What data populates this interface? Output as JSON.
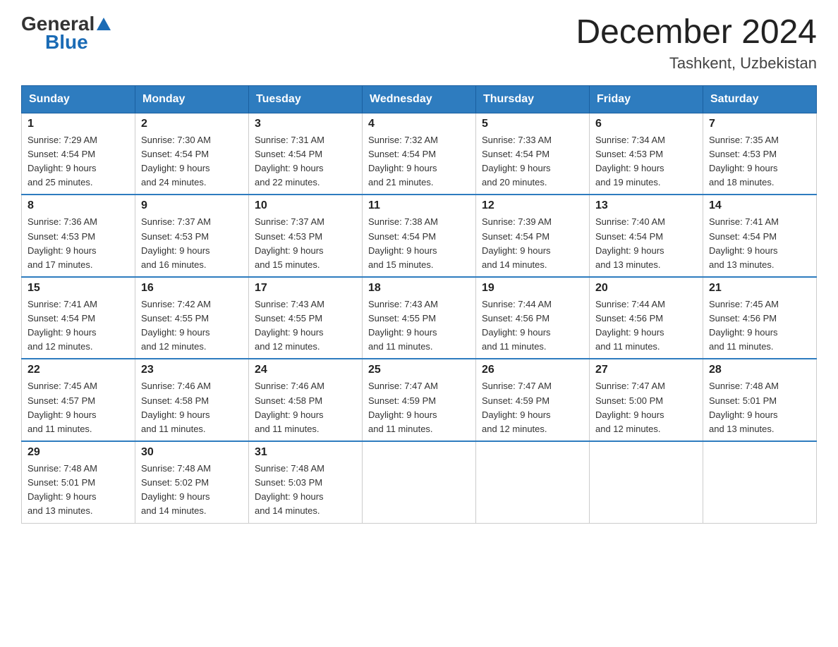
{
  "logo": {
    "general": "General",
    "blue": "Blue",
    "tagline": "Blue"
  },
  "header": {
    "month_year": "December 2024",
    "location": "Tashkent, Uzbekistan"
  },
  "columns": [
    "Sunday",
    "Monday",
    "Tuesday",
    "Wednesday",
    "Thursday",
    "Friday",
    "Saturday"
  ],
  "weeks": [
    [
      {
        "day": "1",
        "sunrise": "7:29 AM",
        "sunset": "4:54 PM",
        "daylight": "9 hours and 25 minutes."
      },
      {
        "day": "2",
        "sunrise": "7:30 AM",
        "sunset": "4:54 PM",
        "daylight": "9 hours and 24 minutes."
      },
      {
        "day": "3",
        "sunrise": "7:31 AM",
        "sunset": "4:54 PM",
        "daylight": "9 hours and 22 minutes."
      },
      {
        "day": "4",
        "sunrise": "7:32 AM",
        "sunset": "4:54 PM",
        "daylight": "9 hours and 21 minutes."
      },
      {
        "day": "5",
        "sunrise": "7:33 AM",
        "sunset": "4:54 PM",
        "daylight": "9 hours and 20 minutes."
      },
      {
        "day": "6",
        "sunrise": "7:34 AM",
        "sunset": "4:53 PM",
        "daylight": "9 hours and 19 minutes."
      },
      {
        "day": "7",
        "sunrise": "7:35 AM",
        "sunset": "4:53 PM",
        "daylight": "9 hours and 18 minutes."
      }
    ],
    [
      {
        "day": "8",
        "sunrise": "7:36 AM",
        "sunset": "4:53 PM",
        "daylight": "9 hours and 17 minutes."
      },
      {
        "day": "9",
        "sunrise": "7:37 AM",
        "sunset": "4:53 PM",
        "daylight": "9 hours and 16 minutes."
      },
      {
        "day": "10",
        "sunrise": "7:37 AM",
        "sunset": "4:53 PM",
        "daylight": "9 hours and 15 minutes."
      },
      {
        "day": "11",
        "sunrise": "7:38 AM",
        "sunset": "4:54 PM",
        "daylight": "9 hours and 15 minutes."
      },
      {
        "day": "12",
        "sunrise": "7:39 AM",
        "sunset": "4:54 PM",
        "daylight": "9 hours and 14 minutes."
      },
      {
        "day": "13",
        "sunrise": "7:40 AM",
        "sunset": "4:54 PM",
        "daylight": "9 hours and 13 minutes."
      },
      {
        "day": "14",
        "sunrise": "7:41 AM",
        "sunset": "4:54 PM",
        "daylight": "9 hours and 13 minutes."
      }
    ],
    [
      {
        "day": "15",
        "sunrise": "7:41 AM",
        "sunset": "4:54 PM",
        "daylight": "9 hours and 12 minutes."
      },
      {
        "day": "16",
        "sunrise": "7:42 AM",
        "sunset": "4:55 PM",
        "daylight": "9 hours and 12 minutes."
      },
      {
        "day": "17",
        "sunrise": "7:43 AM",
        "sunset": "4:55 PM",
        "daylight": "9 hours and 12 minutes."
      },
      {
        "day": "18",
        "sunrise": "7:43 AM",
        "sunset": "4:55 PM",
        "daylight": "9 hours and 11 minutes."
      },
      {
        "day": "19",
        "sunrise": "7:44 AM",
        "sunset": "4:56 PM",
        "daylight": "9 hours and 11 minutes."
      },
      {
        "day": "20",
        "sunrise": "7:44 AM",
        "sunset": "4:56 PM",
        "daylight": "9 hours and 11 minutes."
      },
      {
        "day": "21",
        "sunrise": "7:45 AM",
        "sunset": "4:56 PM",
        "daylight": "9 hours and 11 minutes."
      }
    ],
    [
      {
        "day": "22",
        "sunrise": "7:45 AM",
        "sunset": "4:57 PM",
        "daylight": "9 hours and 11 minutes."
      },
      {
        "day": "23",
        "sunrise": "7:46 AM",
        "sunset": "4:58 PM",
        "daylight": "9 hours and 11 minutes."
      },
      {
        "day": "24",
        "sunrise": "7:46 AM",
        "sunset": "4:58 PM",
        "daylight": "9 hours and 11 minutes."
      },
      {
        "day": "25",
        "sunrise": "7:47 AM",
        "sunset": "4:59 PM",
        "daylight": "9 hours and 11 minutes."
      },
      {
        "day": "26",
        "sunrise": "7:47 AM",
        "sunset": "4:59 PM",
        "daylight": "9 hours and 12 minutes."
      },
      {
        "day": "27",
        "sunrise": "7:47 AM",
        "sunset": "5:00 PM",
        "daylight": "9 hours and 12 minutes."
      },
      {
        "day": "28",
        "sunrise": "7:48 AM",
        "sunset": "5:01 PM",
        "daylight": "9 hours and 13 minutes."
      }
    ],
    [
      {
        "day": "29",
        "sunrise": "7:48 AM",
        "sunset": "5:01 PM",
        "daylight": "9 hours and 13 minutes."
      },
      {
        "day": "30",
        "sunrise": "7:48 AM",
        "sunset": "5:02 PM",
        "daylight": "9 hours and 14 minutes."
      },
      {
        "day": "31",
        "sunrise": "7:48 AM",
        "sunset": "5:03 PM",
        "daylight": "9 hours and 14 minutes."
      },
      null,
      null,
      null,
      null
    ]
  ],
  "labels": {
    "sunrise": "Sunrise:",
    "sunset": "Sunset:",
    "daylight": "Daylight:"
  }
}
